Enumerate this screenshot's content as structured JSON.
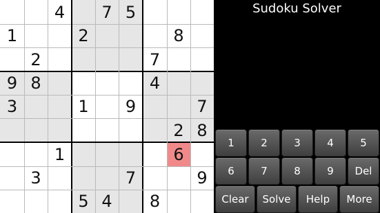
{
  "app": {
    "title": "Sudoku Solver"
  },
  "board": {
    "cells": [
      [
        "",
        "",
        "4",
        "",
        "7",
        "5",
        "",
        "",
        ""
      ],
      [
        "1",
        "",
        "",
        "2",
        "",
        "",
        "",
        "8",
        ""
      ],
      [
        "",
        "2",
        "",
        "",
        "",
        "",
        "7",
        "",
        ""
      ],
      [
        "9",
        "8",
        "",
        "",
        "",
        "",
        "4",
        "",
        ""
      ],
      [
        "3",
        "",
        "",
        "1",
        "",
        "9",
        "",
        "",
        "7"
      ],
      [
        "",
        "",
        "",
        "",
        "",
        "",
        "",
        "2",
        "8"
      ],
      [
        "",
        "",
        "1",
        "",
        "",
        "",
        "",
        "6",
        ""
      ],
      [
        "",
        "3",
        "",
        "",
        "",
        "7",
        "",
        "",
        "9"
      ],
      [
        "",
        "",
        "",
        "5",
        "4",
        "",
        "8",
        "",
        ""
      ]
    ],
    "selected": {
      "row": 6,
      "col": 7
    },
    "colors": {
      "shaded": "#e6e6e6",
      "selected": "#f08a8a"
    }
  },
  "keypad": {
    "row1": [
      "1",
      "2",
      "3",
      "4",
      "5"
    ],
    "row2": [
      "6",
      "7",
      "8",
      "9",
      "Del"
    ],
    "row3": [
      "Clear",
      "Solve",
      "Help",
      "More"
    ]
  }
}
